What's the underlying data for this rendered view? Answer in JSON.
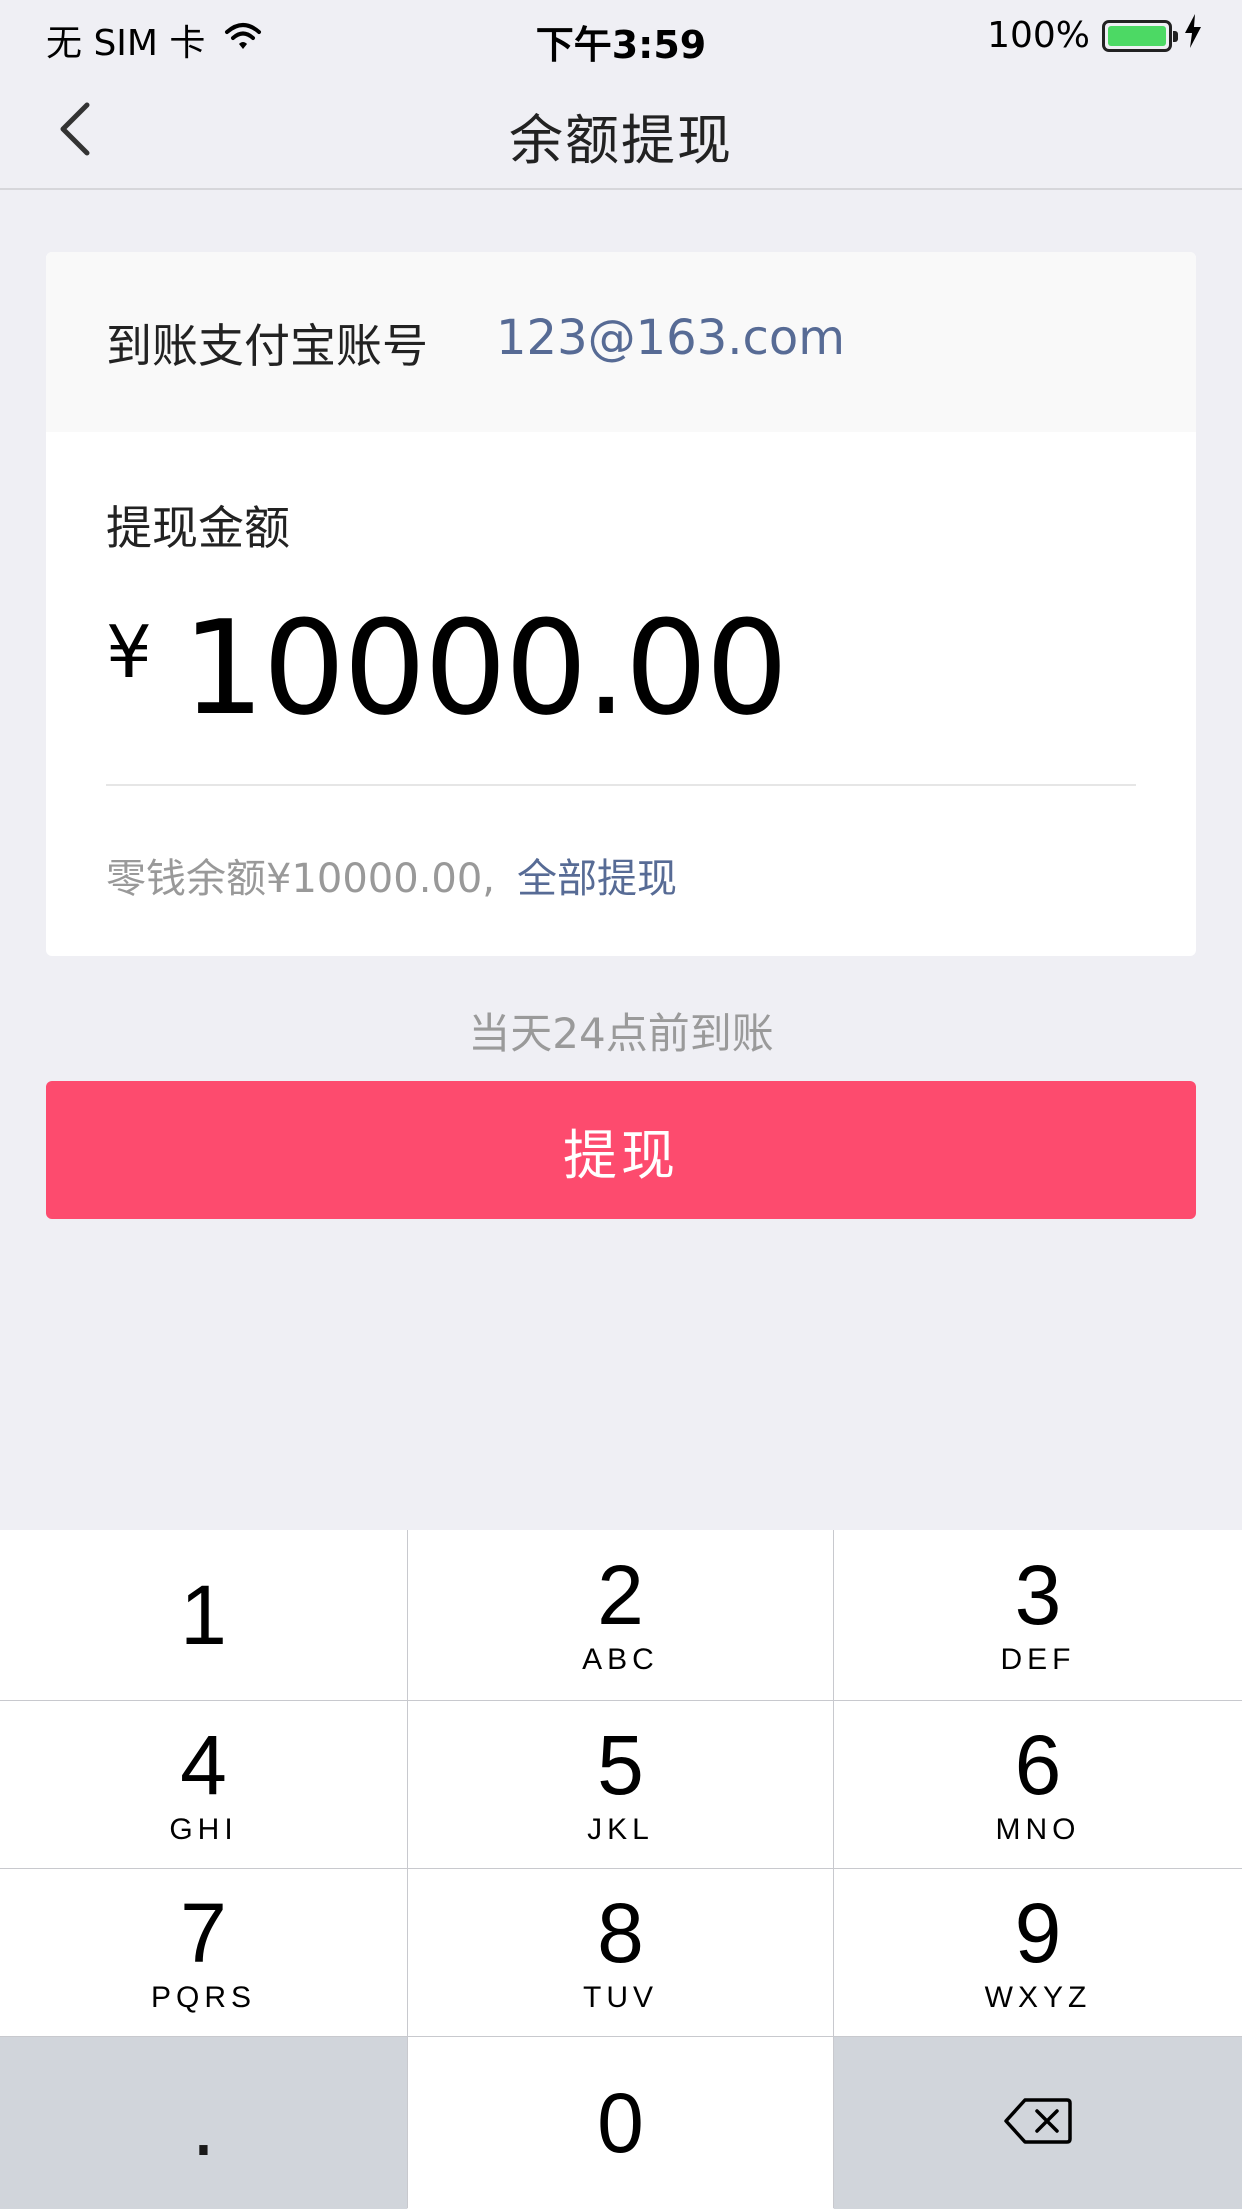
{
  "status_bar": {
    "carrier": "无 SIM 卡",
    "time": "下午3:59",
    "battery_percent": "100%",
    "battery_level": 1.0,
    "battery_color": "#4cd964"
  },
  "nav": {
    "title": "余额提现",
    "back_icon": "chevron-left-icon"
  },
  "account": {
    "label": "到账支付宝账号",
    "value": "123@163.com"
  },
  "amount": {
    "label": "提现金额",
    "currency": "¥",
    "value": "10000.00"
  },
  "balance": {
    "text": "零钱余额¥10000.00,",
    "withdraw_all_label": "全部提现"
  },
  "arrival_note": "当天24点前到账",
  "withdraw_button": {
    "label": "提现",
    "color": "#fd4b6e"
  },
  "colors": {
    "link": "#576b95",
    "background": "#efeff4"
  },
  "keypad": {
    "keys": [
      {
        "digit": "1",
        "letters": ""
      },
      {
        "digit": "2",
        "letters": "ABC"
      },
      {
        "digit": "3",
        "letters": "DEF"
      },
      {
        "digit": "4",
        "letters": "GHI"
      },
      {
        "digit": "5",
        "letters": "JKL"
      },
      {
        "digit": "6",
        "letters": "MNO"
      },
      {
        "digit": "7",
        "letters": "PQRS"
      },
      {
        "digit": "8",
        "letters": "TUV"
      },
      {
        "digit": "9",
        "letters": "WXYZ"
      }
    ],
    "dot": ".",
    "zero": "0",
    "delete_icon": "backspace-icon"
  }
}
